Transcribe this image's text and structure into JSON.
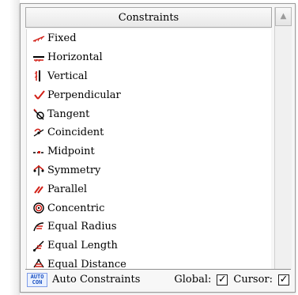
{
  "header": {
    "title": "Constraints"
  },
  "items": [
    {
      "label": "Fixed",
      "icon": "fixed-icon"
    },
    {
      "label": "Horizontal",
      "icon": "horizontal-icon"
    },
    {
      "label": "Vertical",
      "icon": "vertical-icon"
    },
    {
      "label": "Perpendicular",
      "icon": "perpendicular-icon"
    },
    {
      "label": "Tangent",
      "icon": "tangent-icon"
    },
    {
      "label": "Coincident",
      "icon": "coincident-icon"
    },
    {
      "label": "Midpoint",
      "icon": "midpoint-icon"
    },
    {
      "label": "Symmetry",
      "icon": "symmetry-icon"
    },
    {
      "label": "Parallel",
      "icon": "parallel-icon"
    },
    {
      "label": "Concentric",
      "icon": "concentric-icon"
    },
    {
      "label": "Equal Radius",
      "icon": "equal-radius-icon"
    },
    {
      "label": "Equal Length",
      "icon": "equal-length-icon"
    },
    {
      "label": "Equal Distance",
      "icon": "equal-distance-icon"
    }
  ],
  "footer": {
    "auto_label": "Auto Constraints",
    "auto_icon_top": "AUTO",
    "auto_icon_bottom": "CON",
    "global_label": "Global:",
    "cursor_label": "Cursor:",
    "global_checked": true,
    "cursor_checked": true
  },
  "colors": {
    "panel": "#f6f6f6",
    "header": "#eeeeee",
    "accent": "#1c52c2",
    "red_icon": "#d21f16"
  }
}
